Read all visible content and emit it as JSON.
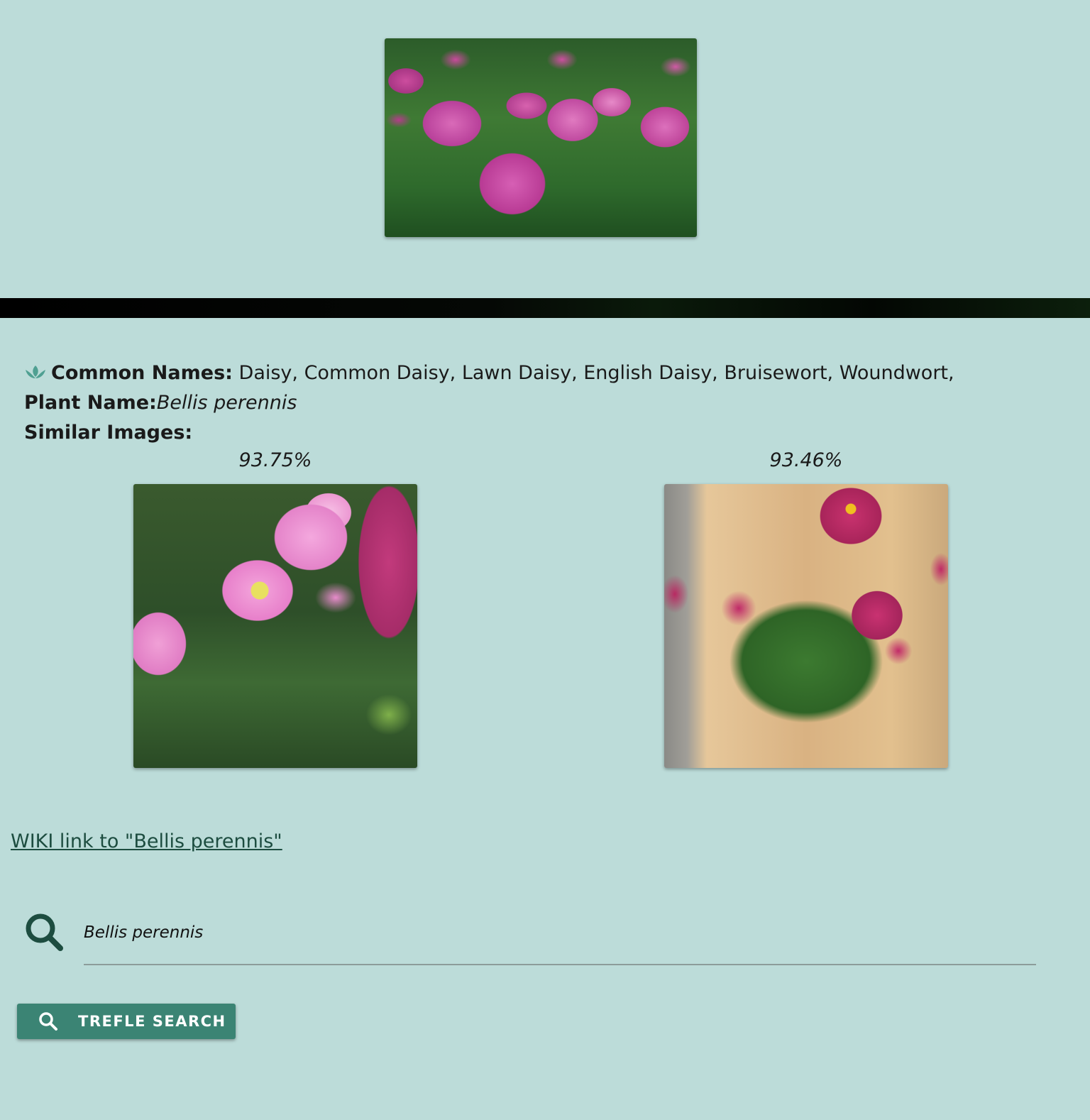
{
  "plant": {
    "common_names_label": "Common Names:",
    "common_names_value": "Daisy, Common Daisy, Lawn Daisy, English Daisy, Bruisewort, Woundwort,",
    "plant_name_label": "Plant Name:",
    "plant_name_value": "Bellis perennis",
    "similar_images_label": "Similar Images:"
  },
  "similar_images": [
    {
      "score": "93.75%"
    },
    {
      "score": "93.46%"
    }
  ],
  "wiki_link": {
    "text": "WIKI link to \"Bellis perennis\""
  },
  "search": {
    "value": "Bellis perennis",
    "icon": "search-icon"
  },
  "trefle_button": {
    "label": "TREFLE SEARCH",
    "icon": "search-icon"
  },
  "colors": {
    "background": "#bcdcd9",
    "accent": "#3b8474",
    "link": "#1d4d40",
    "icon_dark": "#1d4d40",
    "lotus_icon": "#4fa092"
  }
}
